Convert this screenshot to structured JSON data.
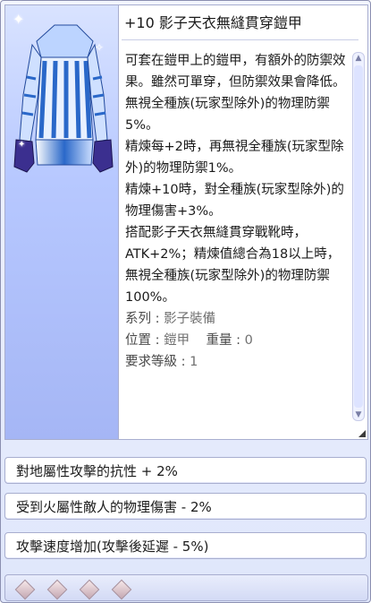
{
  "item": {
    "title": "+10 影子天衣無縫貫穿鎧甲",
    "description": [
      "可套在鎧甲上的鎧甲，有額外的防禦效果。雖然可單穿，但防禦效果會降低。",
      "無視全種族(玩家型除外)的物理防禦5%。",
      "精煉每+2時，再無視全種族(玩家型除外)的物理防禦1%。",
      "精煉+10時，對全種族(玩家型除外)的物理傷害+3%。",
      "搭配影子天衣無縫貫穿戰靴時，ATK+2%；精煉值總合為18以上時，無視全種族(玩家型除外)的物理防禦100%。"
    ],
    "series_label": "系列 :",
    "series_value": "影子裝備",
    "position_label": "位置 :",
    "position_value": "鎧甲",
    "weight_label": "重量 :",
    "weight_value": "0",
    "level_label": "要求等級 :",
    "level_value": "1"
  },
  "options": [
    "對地屬性攻擊的抗性 + 2%",
    "受到火屬性敵人的物理傷害 - 2%",
    "攻擊速度增加(攻擊後延遲 - 5%)"
  ],
  "colors": {
    "armor_main": "#2a68c9",
    "armor_light": "#cfe0ff",
    "panel_border": "#a8aecf"
  }
}
